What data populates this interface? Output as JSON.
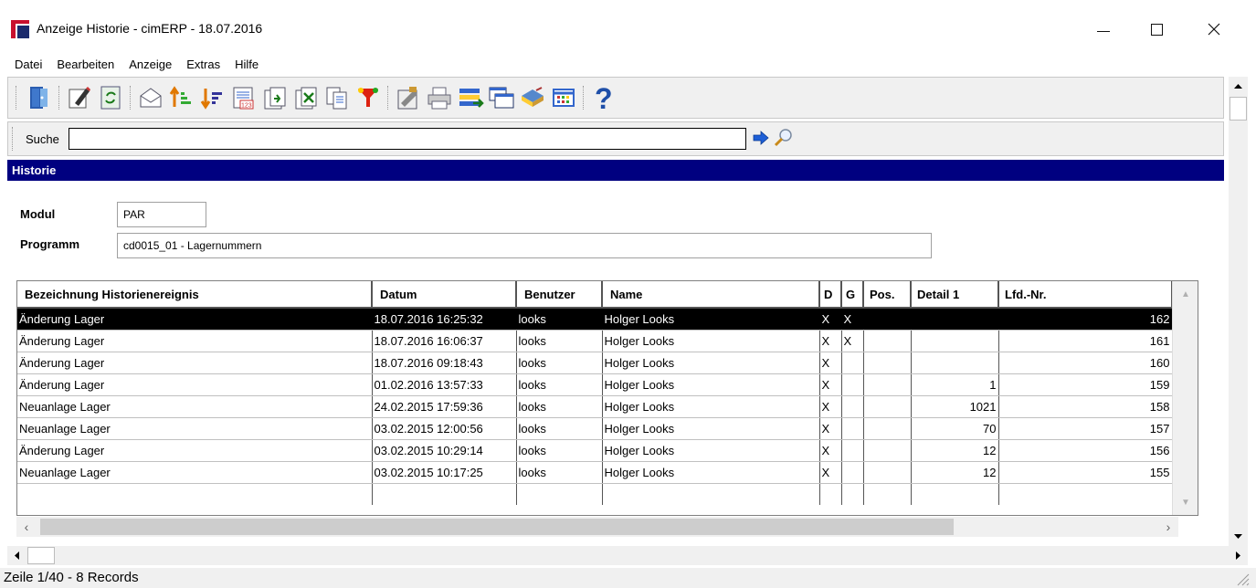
{
  "window": {
    "title": "Anzeige Historie - cimERP - 18.07.2016",
    "minimize": "—",
    "maximize": "☐",
    "close": "✕"
  },
  "menu": {
    "items": [
      "Datei",
      "Bearbeiten",
      "Anzeige",
      "Extras",
      "Hilfe"
    ]
  },
  "toolbar": {
    "icons": [
      "exit-icon",
      "edit-icon",
      "refresh-icon",
      "mail-icon",
      "sort-ascending-icon",
      "sort-descending-icon",
      "number-list-icon",
      "export-icon",
      "excel-export-icon",
      "copy-icon",
      "filter-icon",
      "properties-icon",
      "print-icon",
      "transfer-icon",
      "windows-icon",
      "book-icon",
      "table-icon",
      "help-icon"
    ]
  },
  "search": {
    "label": "Suche",
    "value": ""
  },
  "section": {
    "title": "Historie"
  },
  "form": {
    "modul_label": "Modul",
    "modul_value": "PAR",
    "programm_label": "Programm",
    "programm_value": "cd0015_01 - Lagernummern"
  },
  "grid": {
    "columns": [
      "Bezeichnung Historienereignis",
      "Datum",
      "Benutzer",
      "Name",
      "D",
      "G",
      "Pos.",
      "Detail 1",
      "Lfd.-Nr."
    ],
    "rows": [
      {
        "bez": "Änderung Lager",
        "datum": "18.07.2016 16:25:32",
        "benutzer": "looks",
        "name": "Holger Looks",
        "d": "X",
        "g": "X",
        "pos": "",
        "detail": "",
        "lfd": "162",
        "selected": true
      },
      {
        "bez": "Änderung Lager",
        "datum": "18.07.2016 16:06:37",
        "benutzer": "looks",
        "name": "Holger Looks",
        "d": "X",
        "g": "X",
        "pos": "",
        "detail": "",
        "lfd": "161"
      },
      {
        "bez": "Änderung Lager",
        "datum": "18.07.2016 09:18:43",
        "benutzer": "looks",
        "name": "Holger Looks",
        "d": "X",
        "g": "",
        "pos": "",
        "detail": "",
        "lfd": "160"
      },
      {
        "bez": "Änderung Lager",
        "datum": "01.02.2016 13:57:33",
        "benutzer": "looks",
        "name": "Holger Looks",
        "d": "X",
        "g": "",
        "pos": "",
        "detail": "1",
        "lfd": "159"
      },
      {
        "bez": "Neuanlage Lager",
        "datum": "24.02.2015 17:59:36",
        "benutzer": "looks",
        "name": "Holger Looks",
        "d": "X",
        "g": "",
        "pos": "",
        "detail": "1021",
        "lfd": "158"
      },
      {
        "bez": "Neuanlage Lager",
        "datum": "03.02.2015 12:00:56",
        "benutzer": "looks",
        "name": "Holger Looks",
        "d": "X",
        "g": "",
        "pos": "",
        "detail": "70",
        "lfd": "157"
      },
      {
        "bez": "Änderung Lager",
        "datum": "03.02.2015 10:29:14",
        "benutzer": "looks",
        "name": "Holger Looks",
        "d": "X",
        "g": "",
        "pos": "",
        "detail": "12",
        "lfd": "156"
      },
      {
        "bez": "Neuanlage Lager",
        "datum": "03.02.2015 10:17:25",
        "benutzer": "looks",
        "name": "Holger Looks",
        "d": "X",
        "g": "",
        "pos": "",
        "detail": "12",
        "lfd": "155"
      }
    ]
  },
  "status": {
    "text": "Zeile 1/40 - 8 Records"
  },
  "colors": {
    "section_header": "#000080",
    "selected_row": "#000000"
  }
}
